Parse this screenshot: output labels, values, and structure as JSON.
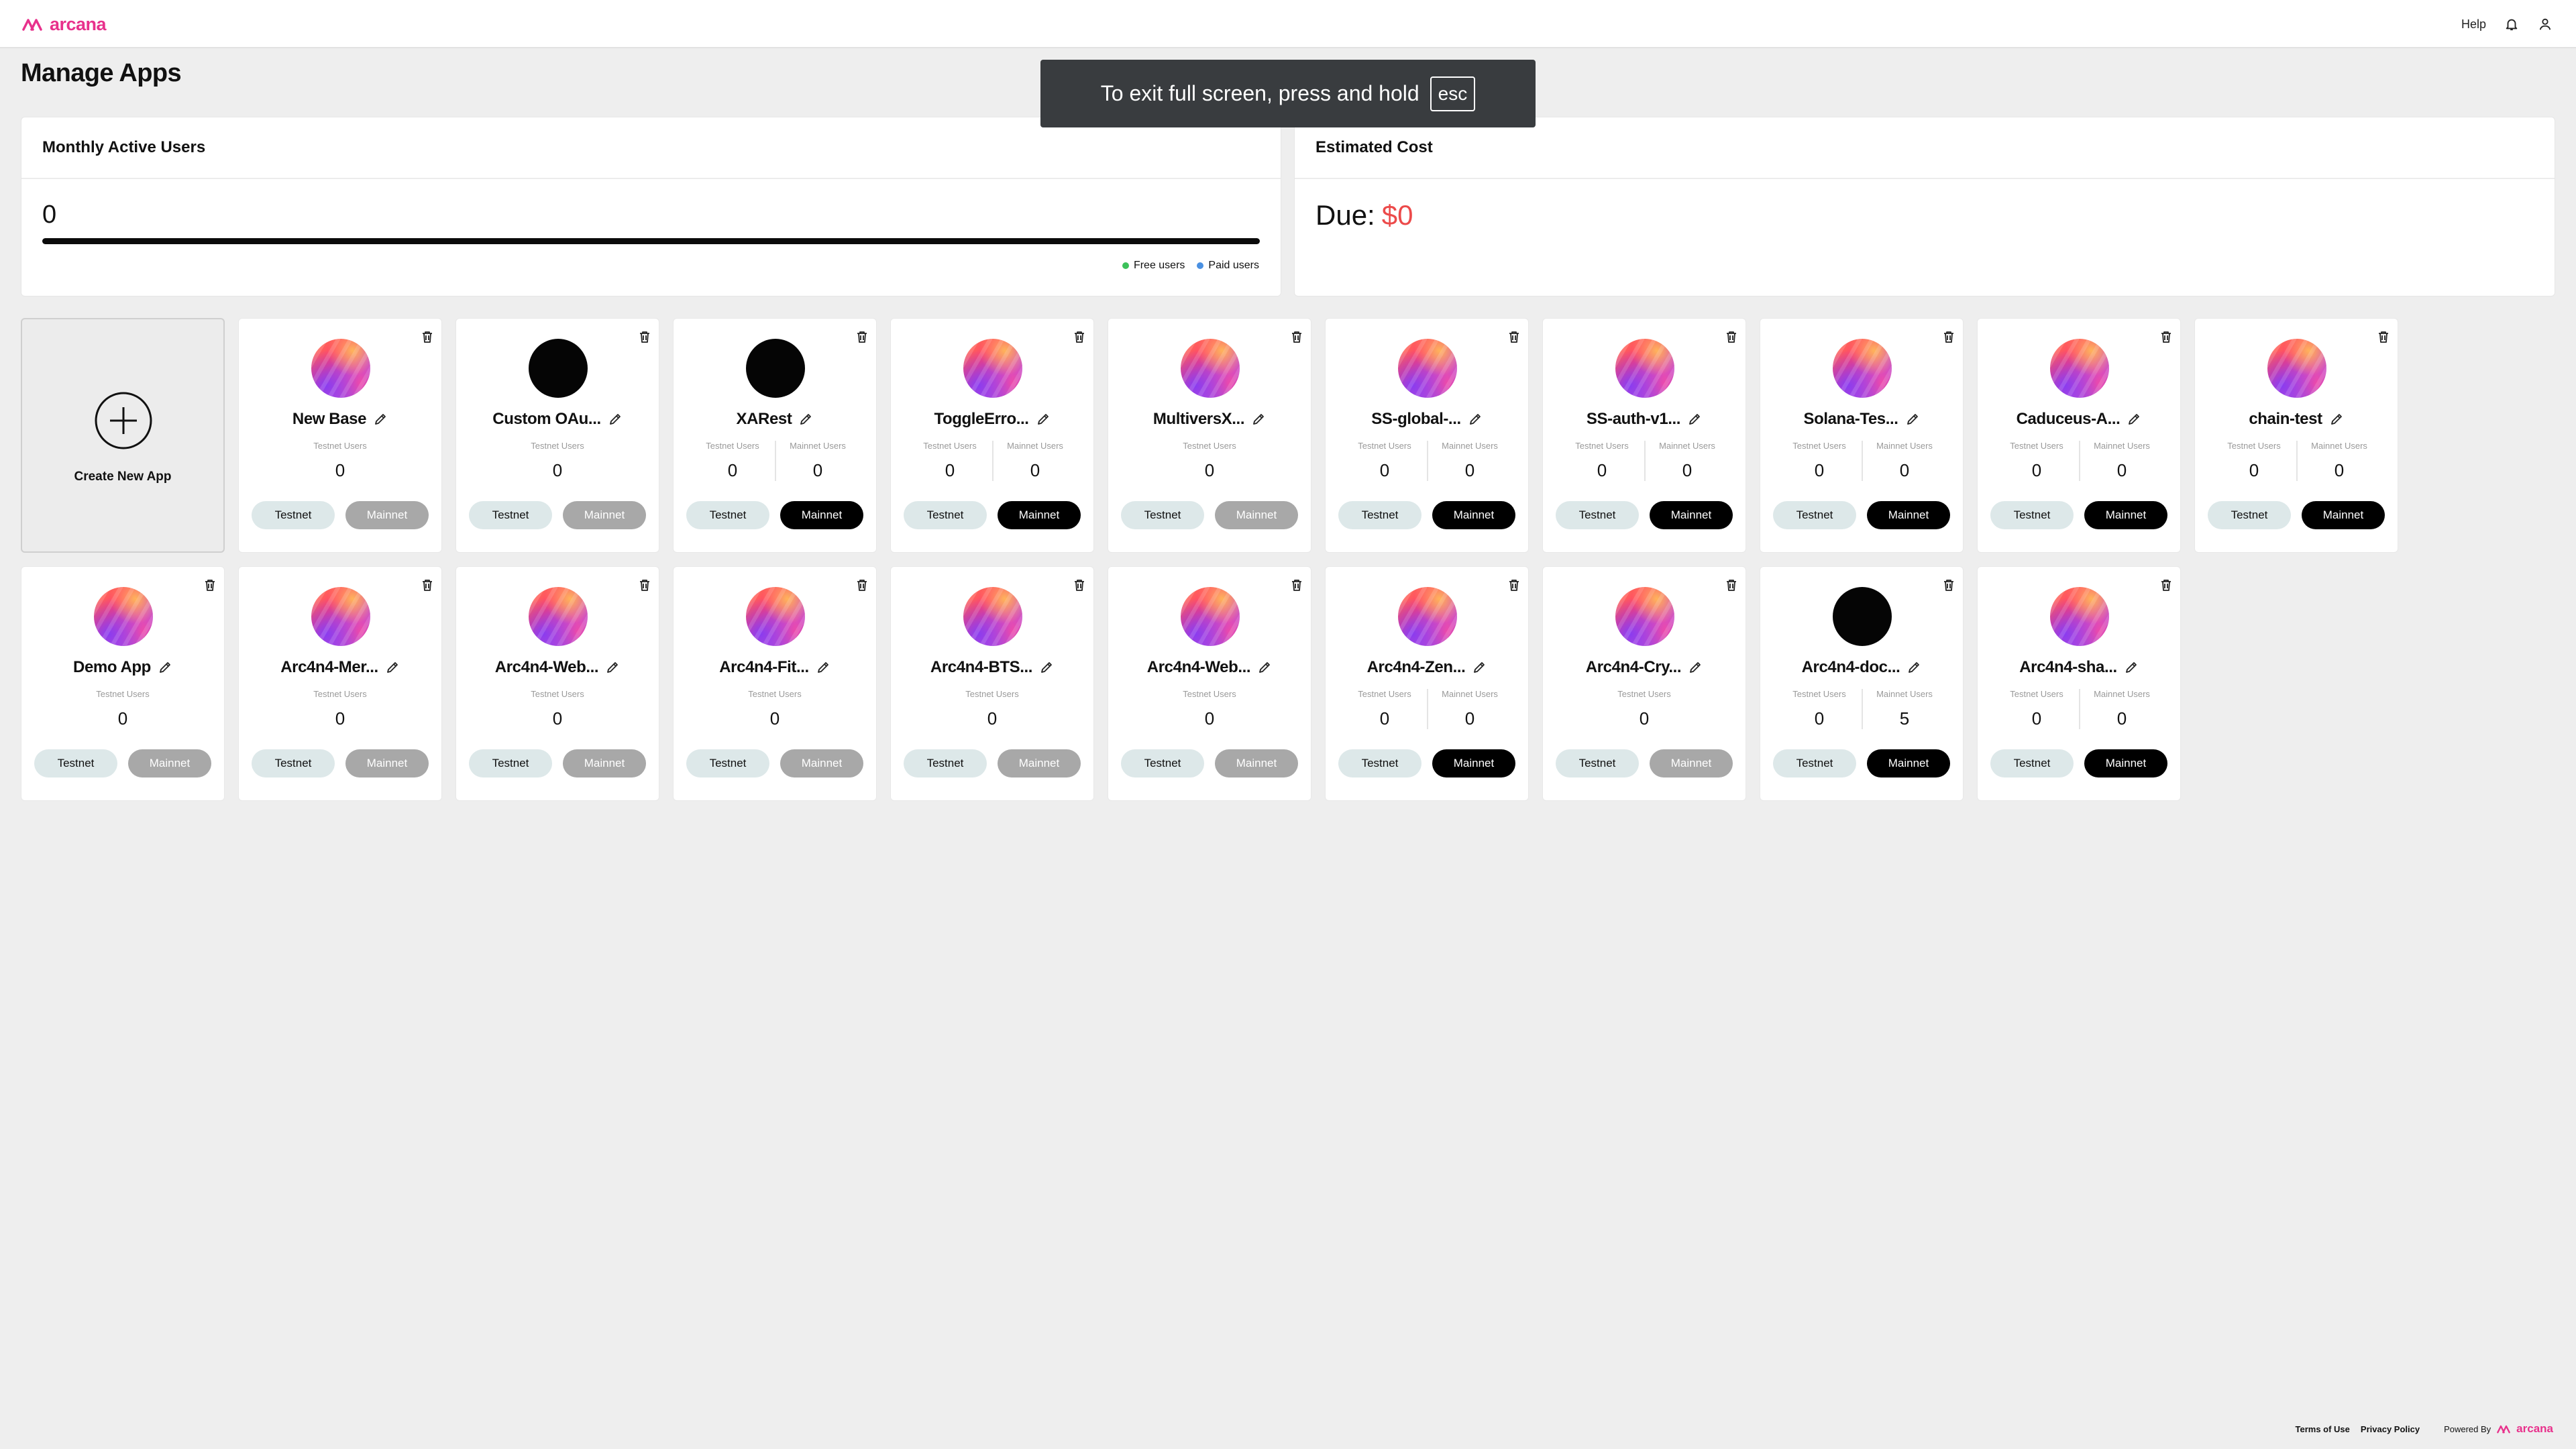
{
  "brand": {
    "name": "arcana",
    "color": "#e8318c"
  },
  "nav": {
    "help": "Help",
    "icons": [
      "bell-icon",
      "user-icon"
    ]
  },
  "page": {
    "title": "Manage Apps"
  },
  "toast": {
    "text": "To exit full screen, press and hold",
    "key": "esc"
  },
  "mau": {
    "title": "Monthly Active Users",
    "value": "0",
    "legend": [
      {
        "label": "Free users",
        "color": "#3cc15a"
      },
      {
        "label": "Paid users",
        "color": "#4a90e2"
      }
    ]
  },
  "cost": {
    "title": "Estimated Cost",
    "due_label": "Due:",
    "amount": "$0",
    "amount_color": "#ec4a4a"
  },
  "create": {
    "label": "Create New App"
  },
  "labels": {
    "testnet_users": "Testnet Users",
    "mainnet_users": "Mainnet Users",
    "testnet_btn": "Testnet",
    "mainnet_btn": "Mainnet"
  },
  "apps": [
    {
      "name": "New Base",
      "avatar": "gradient",
      "mainnet_enabled": false,
      "testnet_users": "0"
    },
    {
      "name": "Custom OAu...",
      "avatar": "black",
      "mainnet_enabled": false,
      "testnet_users": "0"
    },
    {
      "name": "XARest",
      "avatar": "black",
      "mainnet_enabled": true,
      "testnet_users": "0",
      "mainnet_users": "0"
    },
    {
      "name": "ToggleErro...",
      "avatar": "gradient",
      "mainnet_enabled": true,
      "testnet_users": "0",
      "mainnet_users": "0"
    },
    {
      "name": "MultiversX...",
      "avatar": "gradient",
      "mainnet_enabled": false,
      "testnet_users": "0"
    },
    {
      "name": "SS-global-...",
      "avatar": "gradient",
      "mainnet_enabled": true,
      "testnet_users": "0",
      "mainnet_users": "0"
    },
    {
      "name": "SS-auth-v1...",
      "avatar": "gradient",
      "mainnet_enabled": true,
      "testnet_users": "0",
      "mainnet_users": "0"
    },
    {
      "name": "Solana-Tes...",
      "avatar": "gradient",
      "mainnet_enabled": true,
      "testnet_users": "0",
      "mainnet_users": "0"
    },
    {
      "name": "Caduceus-A...",
      "avatar": "gradient",
      "mainnet_enabled": true,
      "testnet_users": "0",
      "mainnet_users": "0"
    },
    {
      "name": "chain-test",
      "avatar": "gradient",
      "mainnet_enabled": true,
      "testnet_users": "0",
      "mainnet_users": "0"
    },
    {
      "name": "Demo App",
      "avatar": "gradient",
      "mainnet_enabled": false,
      "testnet_users": "0"
    },
    {
      "name": "Arc4n4-Mer...",
      "avatar": "gradient",
      "mainnet_enabled": false,
      "testnet_users": "0"
    },
    {
      "name": "Arc4n4-Web...",
      "avatar": "gradient",
      "mainnet_enabled": false,
      "testnet_users": "0"
    },
    {
      "name": "Arc4n4-Fit...",
      "avatar": "gradient",
      "mainnet_enabled": false,
      "testnet_users": "0"
    },
    {
      "name": "Arc4n4-BTS...",
      "avatar": "gradient",
      "mainnet_enabled": false,
      "testnet_users": "0"
    },
    {
      "name": "Arc4n4-Web...",
      "avatar": "gradient",
      "mainnet_enabled": false,
      "testnet_users": "0"
    },
    {
      "name": "Arc4n4-Zen...",
      "avatar": "gradient",
      "mainnet_enabled": true,
      "testnet_users": "0",
      "mainnet_users": "0"
    },
    {
      "name": "Arc4n4-Cry...",
      "avatar": "gradient",
      "mainnet_enabled": false,
      "testnet_users": "0"
    },
    {
      "name": "Arc4n4-doc...",
      "avatar": "black",
      "mainnet_enabled": true,
      "testnet_users": "0",
      "mainnet_users": "5"
    },
    {
      "name": "Arc4n4-sha...",
      "avatar": "gradient",
      "mainnet_enabled": true,
      "testnet_users": "0",
      "mainnet_users": "0"
    }
  ],
  "footer": {
    "terms": "Terms of Use",
    "privacy": "Privacy Policy",
    "powered_by": "Powered By",
    "powered_name": "arcana"
  }
}
